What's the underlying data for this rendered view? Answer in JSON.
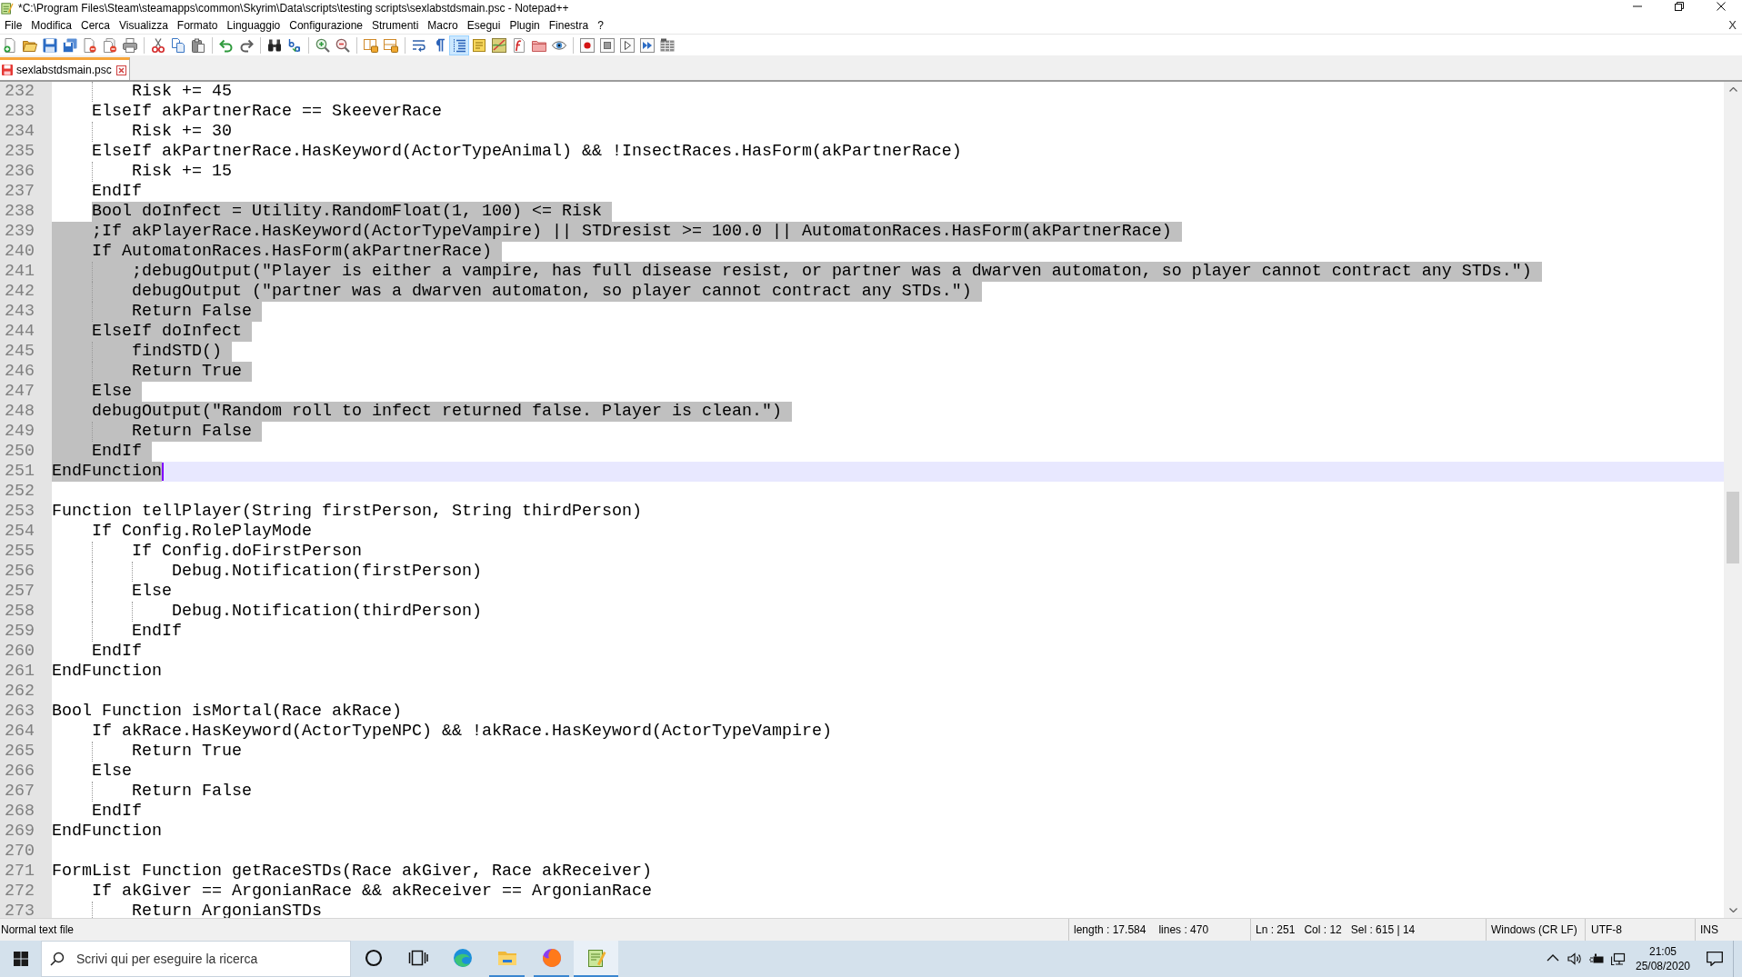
{
  "window": {
    "title": "*C:\\Program Files\\Steam\\steamapps\\common\\Skyrim\\Data\\scripts\\testing scripts\\sexlabstdsmain.psc - Notepad++"
  },
  "menu": [
    "File",
    "Modifica",
    "Cerca",
    "Visualizza",
    "Formato",
    "Linguaggio",
    "Configurazione",
    "Strumenti",
    "Macro",
    "Esegui",
    "Plugin",
    "Finestra",
    "?"
  ],
  "menu_close": "X",
  "toolbar": [
    {
      "kind": "new",
      "pressed": false
    },
    {
      "kind": "open",
      "pressed": false
    },
    {
      "kind": "save",
      "pressed": false
    },
    {
      "kind": "saveall",
      "pressed": false
    },
    {
      "kind": "close",
      "pressed": false
    },
    {
      "kind": "closeall",
      "pressed": false
    },
    {
      "kind": "print",
      "pressed": false
    },
    {
      "kind": "separator"
    },
    {
      "kind": "cut",
      "pressed": false
    },
    {
      "kind": "copy",
      "pressed": false
    },
    {
      "kind": "paste",
      "pressed": false
    },
    {
      "kind": "separator"
    },
    {
      "kind": "undo",
      "pressed": false
    },
    {
      "kind": "redo",
      "pressed": false
    },
    {
      "kind": "separator"
    },
    {
      "kind": "find",
      "pressed": false
    },
    {
      "kind": "replace",
      "pressed": false
    },
    {
      "kind": "separator"
    },
    {
      "kind": "zoomin",
      "pressed": false
    },
    {
      "kind": "zoomout",
      "pressed": false
    },
    {
      "kind": "separator"
    },
    {
      "kind": "syncv",
      "pressed": false
    },
    {
      "kind": "synch",
      "pressed": false
    },
    {
      "kind": "separator"
    },
    {
      "kind": "wrap",
      "pressed": false
    },
    {
      "kind": "allchars",
      "pressed": false
    },
    {
      "kind": "indentguide",
      "pressed": true
    },
    {
      "kind": "udl",
      "pressed": false
    },
    {
      "kind": "docmap",
      "pressed": false
    },
    {
      "kind": "funclist",
      "pressed": false
    },
    {
      "kind": "workspace",
      "pressed": false
    },
    {
      "kind": "monitor",
      "pressed": false
    },
    {
      "kind": "separator"
    },
    {
      "kind": "record",
      "pressed": false
    },
    {
      "kind": "stop",
      "pressed": false
    },
    {
      "kind": "play",
      "pressed": false
    },
    {
      "kind": "playmulti",
      "pressed": false
    },
    {
      "kind": "savemacro",
      "pressed": false
    }
  ],
  "tabs": [
    {
      "label": "sexlabstdsmain.psc",
      "selected": true,
      "modified": true
    }
  ],
  "editor": {
    "lines": [
      {
        "number": "232",
        "text": "\t\tRisk += 45",
        "selected": false,
        "current": false
      },
      {
        "number": "233",
        "text": "\tElseIf akPartnerRace == SkeeverRace",
        "selected": false,
        "current": false
      },
      {
        "number": "234",
        "text": "\t\tRisk += 30",
        "selected": false,
        "current": false
      },
      {
        "number": "235",
        "text": "\tElseIf akPartnerRace.HasKeyword(ActorTypeAnimal) && !InsectRaces.HasForm(akPartnerRace)",
        "selected": false,
        "current": false
      },
      {
        "number": "236",
        "text": "\t\tRisk += 15",
        "selected": false,
        "current": false
      },
      {
        "number": "237",
        "text": "\tEndIf",
        "selected": false,
        "current": false
      },
      {
        "number": "238",
        "text": "\tBool doInfect = Utility.RandomFloat(1, 100) <= Risk",
        "selected": true,
        "selection_skips_indent": true,
        "current": false
      },
      {
        "number": "239",
        "text": "\t;If akPlayerRace.HasKeyword(ActorTypeVampire) || STDresist >= 100.0 || AutomatonRaces.HasForm(akPartnerRace)",
        "selected": true,
        "current": false
      },
      {
        "number": "240",
        "text": "\tIf AutomatonRaces.HasForm(akPartnerRace)",
        "selected": true,
        "current": false
      },
      {
        "number": "241",
        "text": "\t\t;debugOutput(\"Player is either a vampire, has full disease resist, or partner was a dwarven automaton, so player cannot contract any STDs.\")",
        "selected": true,
        "current": false
      },
      {
        "number": "242",
        "text": "\t\tdebugOutput (\"partner was a dwarven automaton, so player cannot contract any STDs.\")",
        "selected": true,
        "current": false
      },
      {
        "number": "243",
        "text": "\t\tReturn False",
        "selected": true,
        "current": false
      },
      {
        "number": "244",
        "text": "\tElseIf doInfect",
        "selected": true,
        "current": false
      },
      {
        "number": "245",
        "text": "\t\tfindSTD()",
        "selected": true,
        "current": false
      },
      {
        "number": "246",
        "text": "\t\tReturn True",
        "selected": true,
        "current": false
      },
      {
        "number": "247",
        "text": "\tElse",
        "selected": true,
        "current": false
      },
      {
        "number": "248",
        "text": "\tdebugOutput(\"Random roll to infect returned false. Player is clean.\")",
        "selected": true,
        "current": false
      },
      {
        "number": "249",
        "text": "\t\tReturn False",
        "selected": true,
        "current": false
      },
      {
        "number": "250",
        "text": "\tEndIf",
        "selected": true,
        "current": false
      },
      {
        "number": "251",
        "text": "EndFunction",
        "selected": true,
        "current": true
      },
      {
        "number": "252",
        "selected": false,
        "current": false
      },
      {
        "number": "253",
        "text": "Function tellPlayer(String firstPerson, String thirdPerson)",
        "selected": false,
        "current": false
      },
      {
        "number": "254",
        "text": "\tIf Config.RolePlayMode",
        "selected": false,
        "current": false
      },
      {
        "number": "255",
        "text": "\t\tIf Config.doFirstPerson",
        "selected": false,
        "current": false
      },
      {
        "number": "256",
        "text": "\t\t\tDebug.Notification(firstPerson)",
        "selected": false,
        "current": false
      },
      {
        "number": "257",
        "text": "\t\tElse",
        "selected": false,
        "current": false
      },
      {
        "number": "258",
        "text": "\t\t\tDebug.Notification(thirdPerson)",
        "selected": false,
        "current": false
      },
      {
        "number": "259",
        "text": "\t\tEndIf",
        "selected": false,
        "current": false
      },
      {
        "number": "260",
        "text": "\tEndIf",
        "selected": false,
        "current": false
      },
      {
        "number": "261",
        "text": "EndFunction",
        "selected": false,
        "current": false
      },
      {
        "number": "262",
        "selected": false,
        "current": false
      },
      {
        "number": "263",
        "text": "Bool Function isMortal(Race akRace)",
        "selected": false,
        "current": false
      },
      {
        "number": "264",
        "text": "\tIf akRace.HasKeyword(ActorTypeNPC) && !akRace.HasKeyword(ActorTypeVampire)",
        "selected": false,
        "current": false
      },
      {
        "number": "265",
        "text": "\t\tReturn True",
        "selected": false,
        "current": false
      },
      {
        "number": "266",
        "text": "\tElse",
        "selected": false,
        "current": false
      },
      {
        "number": "267",
        "text": "\t\tReturn False",
        "selected": false,
        "current": false
      },
      {
        "number": "268",
        "text": "\tEndIf",
        "selected": false,
        "current": false
      },
      {
        "number": "269",
        "text": "EndFunction",
        "selected": false,
        "current": false
      },
      {
        "number": "270",
        "selected": false,
        "current": false
      },
      {
        "number": "271",
        "text": "FormList Function getRaceSTDs(Race akGiver, Race akReceiver)",
        "selected": false,
        "current": false
      },
      {
        "number": "272",
        "text": "\tIf akGiver == ArgonianRace && akReceiver == ArgonianRace",
        "selected": false,
        "current": false
      },
      {
        "number": "273",
        "text": "\t\tReturn ArgonianSTDs",
        "selected": false,
        "current": false
      }
    ]
  },
  "status_bar": {
    "file_type": "Normal text file",
    "length": "length : 17.584",
    "lines": "lines : 470",
    "line": "Ln : 251",
    "column": "Col : 12",
    "selection": "Sel : 615 | 14",
    "eol": "Windows (CR LF)",
    "encoding": "UTF-8",
    "mode": "INS"
  },
  "taskbar": {
    "search": {
      "placeholder": "Scrivi qui per eseguire la ricerca"
    },
    "apps": [
      {
        "kind": "ring",
        "running": false,
        "active": false
      },
      {
        "kind": "taskview",
        "running": false,
        "active": false
      },
      {
        "kind": "wave",
        "running": false,
        "active": false
      },
      {
        "kind": "folder",
        "running": true,
        "active": false
      },
      {
        "kind": "fox",
        "running": true,
        "active": false
      },
      {
        "kind": "notepad",
        "running": true,
        "active": true
      }
    ],
    "clock": {
      "time": "21:05",
      "date": "25/08/2020"
    }
  }
}
